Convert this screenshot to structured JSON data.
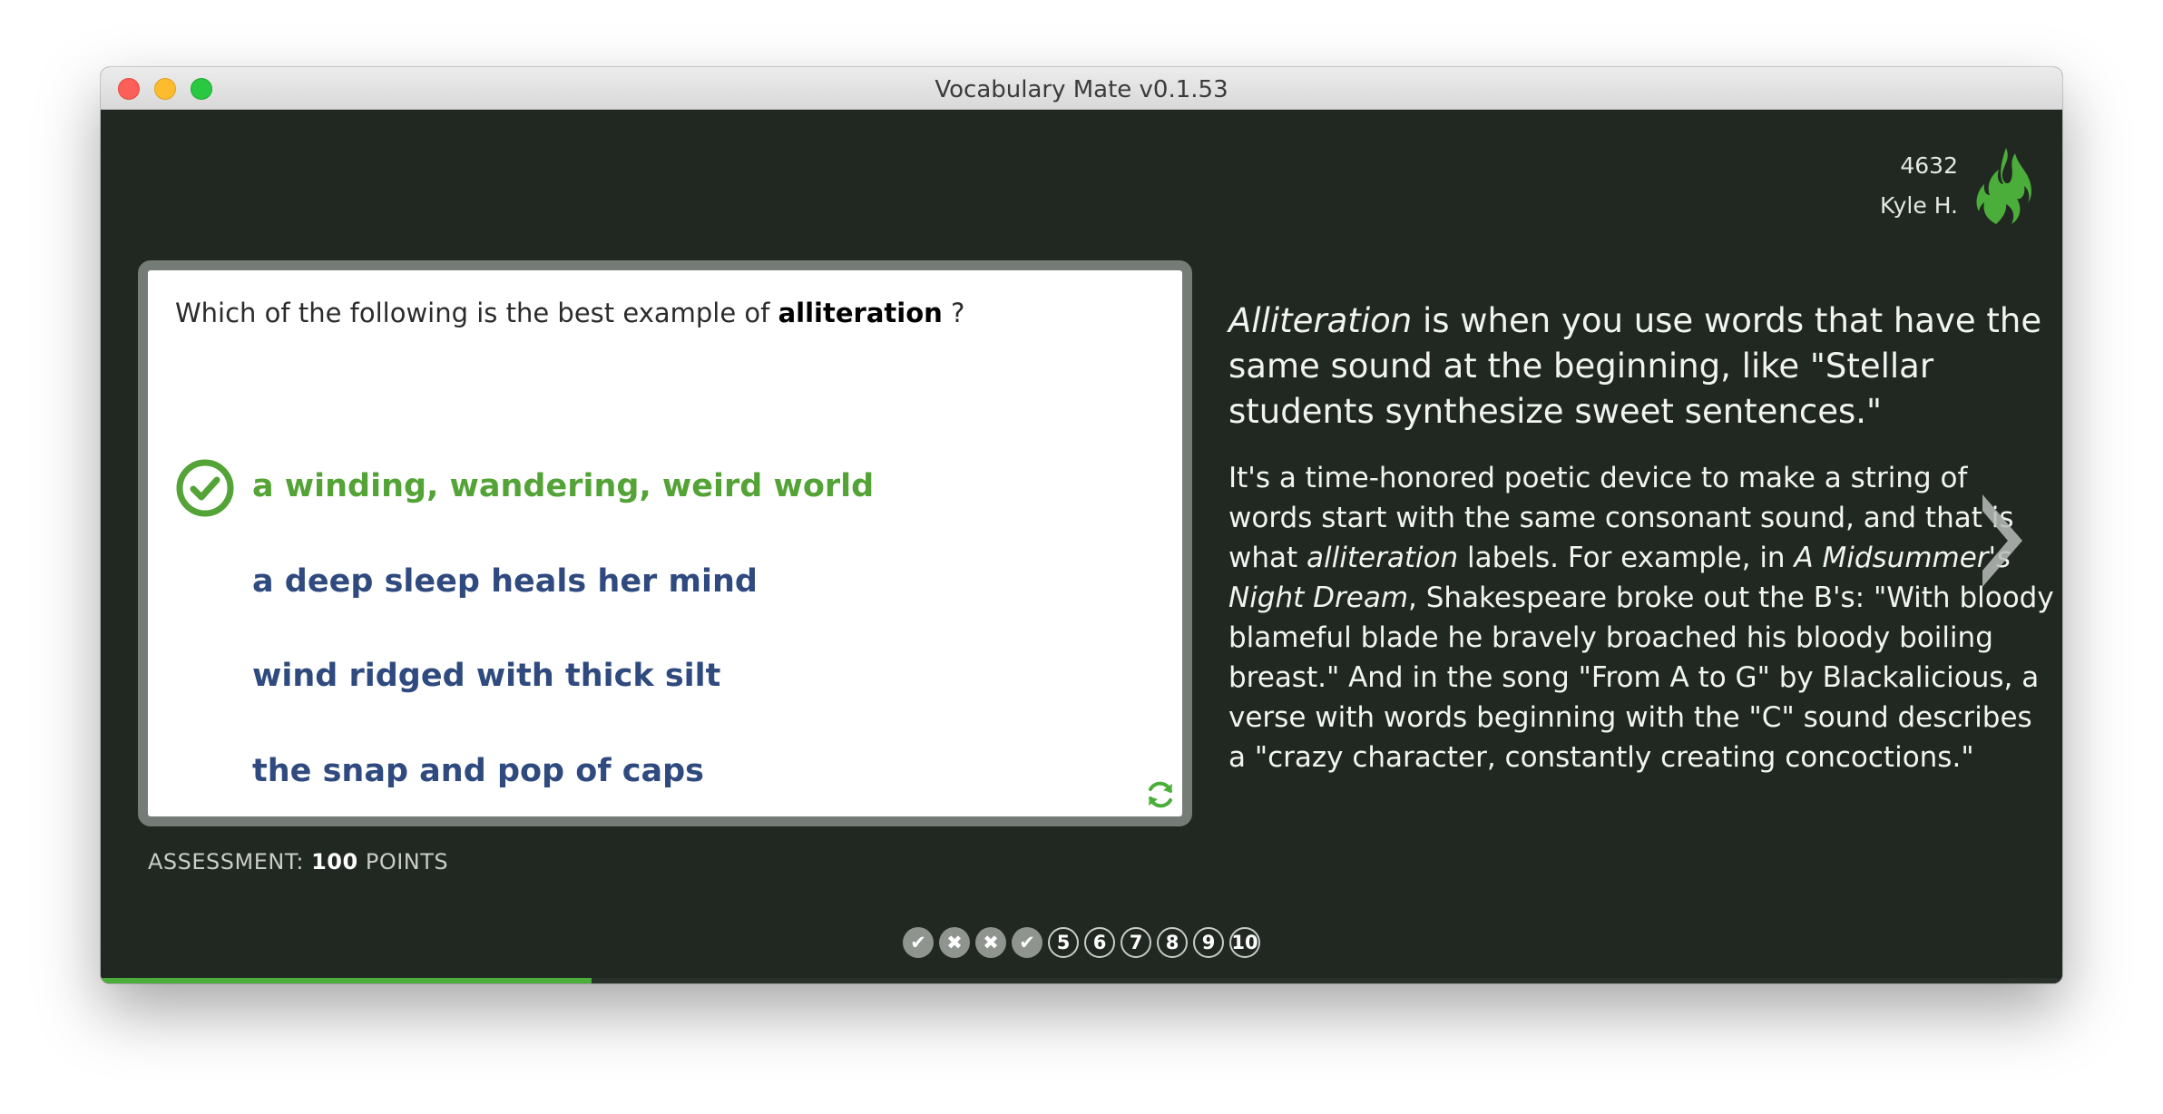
{
  "window": {
    "title": "Vocabulary Mate v0.1.53"
  },
  "user": {
    "points": "4632",
    "name": "Kyle H.",
    "icon": "flame-icon"
  },
  "question": {
    "prefix": "Which of the following is the best example of ",
    "term": "alliteration",
    "suffix": " ?"
  },
  "answers": [
    {
      "text": "a winding, wandering, weird world",
      "correct": true
    },
    {
      "text": "a deep sleep heals her mind",
      "correct": false
    },
    {
      "text": "wind ridged with thick silt",
      "correct": false
    },
    {
      "text": "the snap and pop of caps",
      "correct": false
    }
  ],
  "assessment": {
    "label": "ASSESSMENT:",
    "points": "100",
    "unit": "POINTS"
  },
  "explanation": {
    "lead_term": "Alliteration",
    "lead_rest": " is when you use words that have the same sound at the beginning, like \"Stellar students synthesize sweet sentences.\"",
    "body_1": "It's a time-honored poetic device to make a string of words start with the same consonant sound, and that is what ",
    "body_term": "alliteration",
    "body_2": " labels. For example, in ",
    "body_title": "A Midsummer's Night Dream",
    "body_3": ", Shakespeare broke out the B's: \"With bloody blameful blade he bravely broached his bloody boiling breast.\" And in the song \"From A to G\" by Blackalicious, a verse with words beginning with the \"C\" sound describes a \"crazy character, constantly creating concoctions.\""
  },
  "progress": {
    "steps": [
      {
        "label": "✔",
        "status": "correct"
      },
      {
        "label": "✖",
        "status": "wrong"
      },
      {
        "label": "✖",
        "status": "wrong"
      },
      {
        "label": "✔",
        "status": "correct"
      },
      {
        "label": "5",
        "status": "pending"
      },
      {
        "label": "6",
        "status": "pending"
      },
      {
        "label": "7",
        "status": "pending"
      },
      {
        "label": "8",
        "status": "pending"
      },
      {
        "label": "9",
        "status": "pending"
      },
      {
        "label": "10",
        "status": "pending"
      }
    ],
    "completed_fraction": 0.25
  },
  "colors": {
    "background": "#212821",
    "correct_green": "#53a336",
    "answer_blue": "#2f4a7f",
    "progress_green": "#4cae3a"
  }
}
